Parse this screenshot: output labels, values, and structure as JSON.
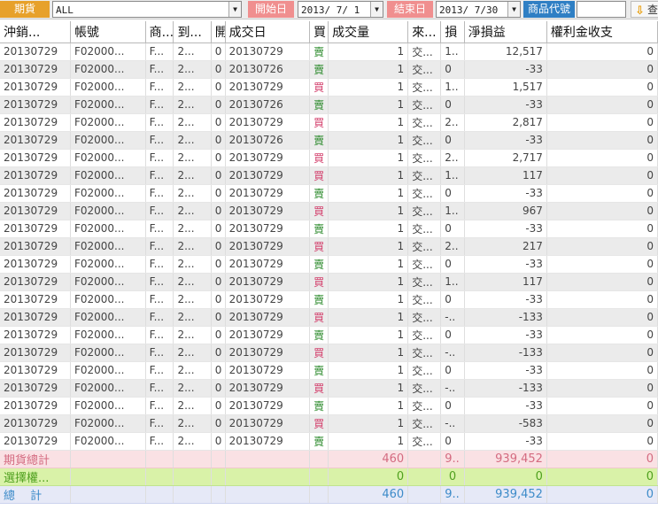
{
  "toolbar": {
    "futures_label": "期貨",
    "account": "ALL",
    "start_label": "開始日",
    "start_date": "2013/ 7/ 1",
    "end_label": "結束日",
    "end_date": "2013/ 7/30",
    "product_code_label": "商品代號",
    "product_code": "",
    "query_label": "查"
  },
  "colors": {
    "futures_label_bg": "#e7a12b",
    "date_label_bg": "#f08f8f",
    "code_label_bg": "#2f7fc4",
    "buy": "#d33f6c",
    "sell": "#2b8a2b"
  },
  "columns": [
    "沖銷...",
    "帳號",
    "商...",
    "到...",
    "開",
    "成交日",
    "買",
    "成交量",
    "來...",
    "損",
    "淨損益",
    "權利金收支"
  ],
  "rows": [
    [
      "20130729",
      "F02000...",
      "F...",
      "2...",
      "0",
      "20130729",
      "賣",
      "1",
      "交...",
      "1..",
      "12,517",
      "0"
    ],
    [
      "20130729",
      "F02000...",
      "F...",
      "2...",
      "0",
      "20130726",
      "賣",
      "1",
      "交...",
      "0",
      "-33",
      "0"
    ],
    [
      "20130729",
      "F02000...",
      "F...",
      "2...",
      "0",
      "20130729",
      "買",
      "1",
      "交...",
      "1..",
      "1,517",
      "0"
    ],
    [
      "20130729",
      "F02000...",
      "F...",
      "2...",
      "0",
      "20130726",
      "賣",
      "1",
      "交...",
      "0",
      "-33",
      "0"
    ],
    [
      "20130729",
      "F02000...",
      "F...",
      "2...",
      "0",
      "20130729",
      "買",
      "1",
      "交...",
      "2..",
      "2,817",
      "0"
    ],
    [
      "20130729",
      "F02000...",
      "F...",
      "2...",
      "0",
      "20130726",
      "賣",
      "1",
      "交...",
      "0",
      "-33",
      "0"
    ],
    [
      "20130729",
      "F02000...",
      "F...",
      "2...",
      "0",
      "20130729",
      "買",
      "1",
      "交...",
      "2..",
      "2,717",
      "0"
    ],
    [
      "20130729",
      "F02000...",
      "F...",
      "2...",
      "0",
      "20130729",
      "買",
      "1",
      "交...",
      "1..",
      "117",
      "0"
    ],
    [
      "20130729",
      "F02000...",
      "F...",
      "2...",
      "0",
      "20130729",
      "賣",
      "1",
      "交...",
      "0",
      "-33",
      "0"
    ],
    [
      "20130729",
      "F02000...",
      "F...",
      "2...",
      "0",
      "20130729",
      "買",
      "1",
      "交...",
      "1..",
      "967",
      "0"
    ],
    [
      "20130729",
      "F02000...",
      "F...",
      "2...",
      "0",
      "20130729",
      "賣",
      "1",
      "交...",
      "0",
      "-33",
      "0"
    ],
    [
      "20130729",
      "F02000...",
      "F...",
      "2...",
      "0",
      "20130729",
      "買",
      "1",
      "交...",
      "2..",
      "217",
      "0"
    ],
    [
      "20130729",
      "F02000...",
      "F...",
      "2...",
      "0",
      "20130729",
      "賣",
      "1",
      "交...",
      "0",
      "-33",
      "0"
    ],
    [
      "20130729",
      "F02000...",
      "F...",
      "2...",
      "0",
      "20130729",
      "買",
      "1",
      "交...",
      "1..",
      "117",
      "0"
    ],
    [
      "20130729",
      "F02000...",
      "F...",
      "2...",
      "0",
      "20130729",
      "賣",
      "1",
      "交...",
      "0",
      "-33",
      "0"
    ],
    [
      "20130729",
      "F02000...",
      "F...",
      "2...",
      "0",
      "20130729",
      "買",
      "1",
      "交...",
      "-..",
      "-133",
      "0"
    ],
    [
      "20130729",
      "F02000...",
      "F...",
      "2...",
      "0",
      "20130729",
      "賣",
      "1",
      "交...",
      "0",
      "-33",
      "0"
    ],
    [
      "20130729",
      "F02000...",
      "F...",
      "2...",
      "0",
      "20130729",
      "買",
      "1",
      "交...",
      "-..",
      "-133",
      "0"
    ],
    [
      "20130729",
      "F02000...",
      "F...",
      "2...",
      "0",
      "20130729",
      "賣",
      "1",
      "交...",
      "0",
      "-33",
      "0"
    ],
    [
      "20130729",
      "F02000...",
      "F...",
      "2...",
      "0",
      "20130729",
      "買",
      "1",
      "交...",
      "-..",
      "-133",
      "0"
    ],
    [
      "20130729",
      "F02000...",
      "F...",
      "2...",
      "0",
      "20130729",
      "賣",
      "1",
      "交...",
      "0",
      "-33",
      "0"
    ],
    [
      "20130729",
      "F02000...",
      "F...",
      "2...",
      "0",
      "20130729",
      "買",
      "1",
      "交...",
      "-..",
      "-583",
      "0"
    ],
    [
      "20130729",
      "F02000...",
      "F...",
      "2...",
      "0",
      "20130729",
      "賣",
      "1",
      "交...",
      "0",
      "-33",
      "0"
    ]
  ],
  "summary": {
    "futures": {
      "label": "期貨總計",
      "volume": "460",
      "loss": "9..",
      "net": "939,452",
      "premium": "0"
    },
    "options": {
      "label": "選擇權...",
      "volume": "0",
      "loss": "0",
      "net": "0",
      "premium": "0"
    },
    "total": {
      "label": "總　 計",
      "volume": "460",
      "loss": "9..",
      "net": "939,452",
      "premium": "0"
    }
  }
}
